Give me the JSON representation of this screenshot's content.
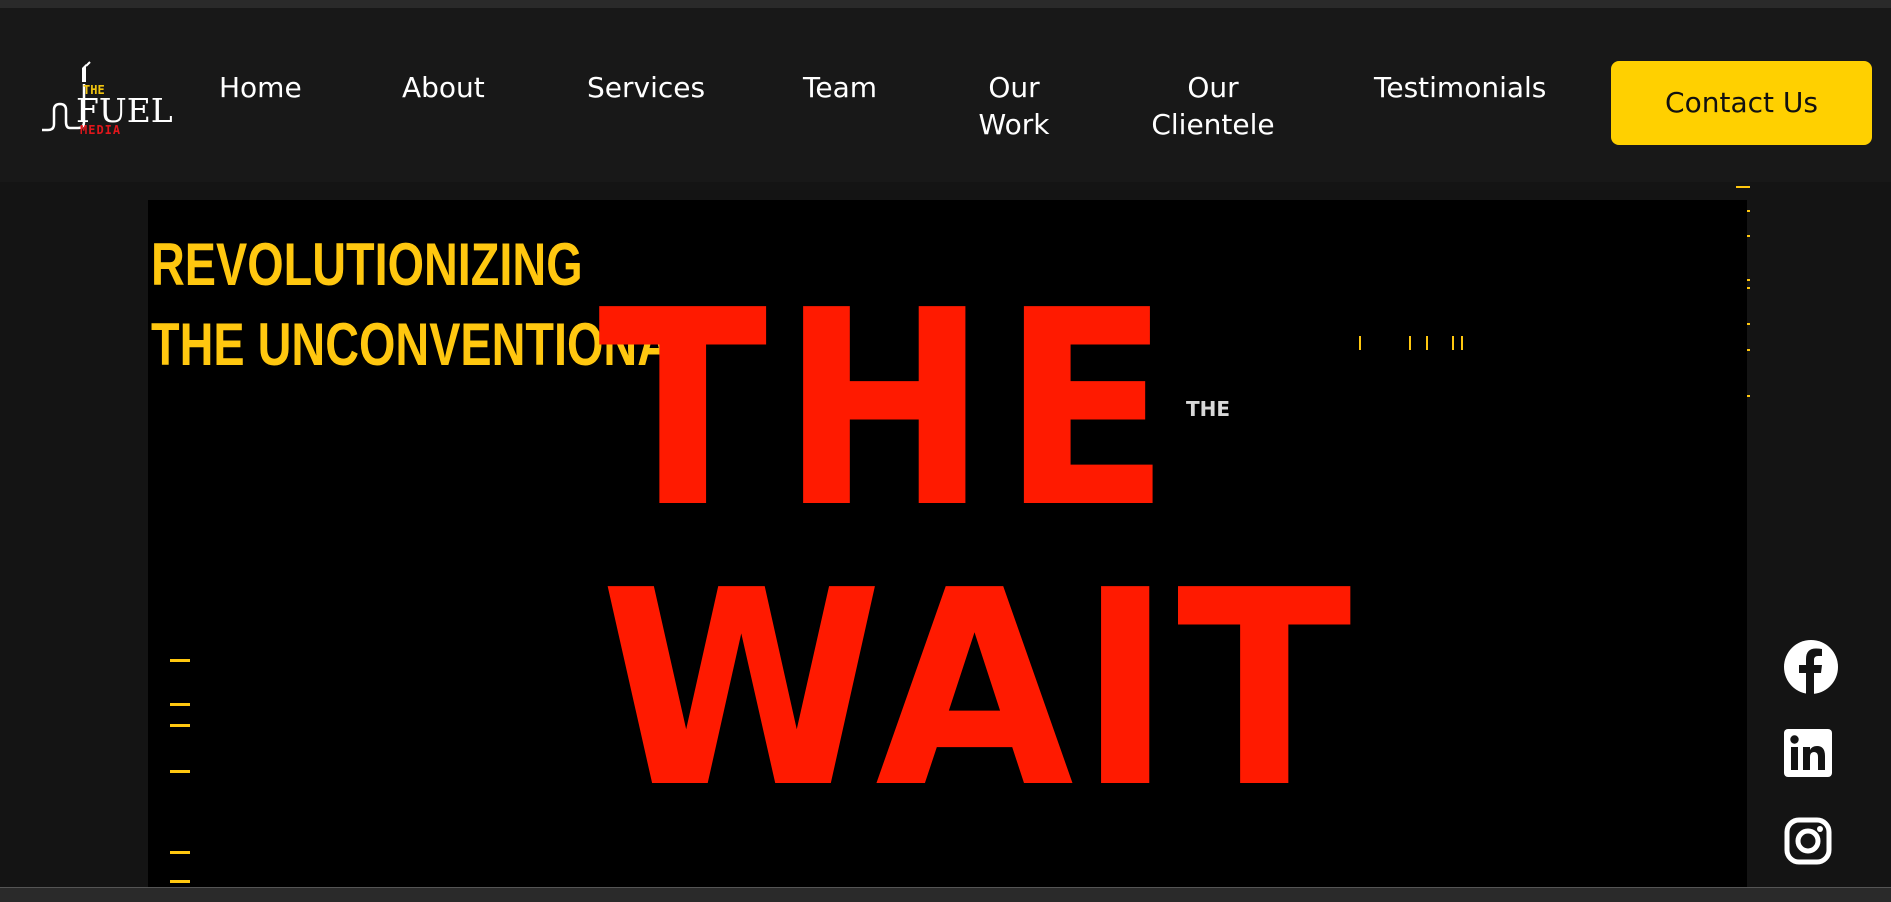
{
  "brand": {
    "logo_the": "THE",
    "logo_fuel": "FUEL",
    "logo_media": "MEDIA"
  },
  "nav": {
    "home": "Home",
    "about": "About",
    "services": "Services",
    "team": "Team",
    "our_work_1": "Our",
    "our_work_2": "Work",
    "our_clientele_1": "Our",
    "our_clientele_2": "Clientele",
    "testimonials": "Testimonials",
    "contact": "Contact Us"
  },
  "hero": {
    "tagline_1": "REVOLUTIONIZING",
    "tagline_2": "THE UNCONVENTIONAL",
    "big_line_1": "THE",
    "big_line_2": "WAIT",
    "small_word": "THE"
  },
  "social": {
    "icons": [
      "facebook-icon",
      "linkedin-icon",
      "instagram-icon"
    ]
  },
  "colors": {
    "header_bg": "#181818",
    "accent_yellow": "#ffd000",
    "hero_red": "#ff1a00",
    "tagline_yellow": "#ffc70f"
  }
}
